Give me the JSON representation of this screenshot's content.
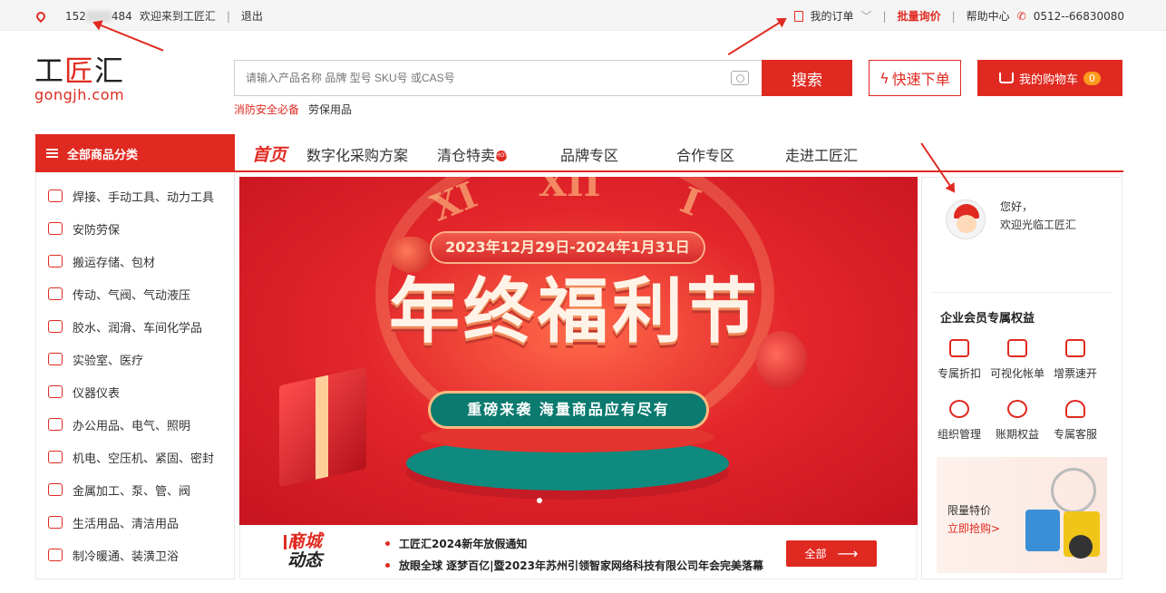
{
  "topbar": {
    "phone_masked_start": "152",
    "phone_masked_end": "484",
    "welcome": "欢迎来到工匠汇",
    "logout": "退出",
    "my_orders": "我的订单",
    "bulk_inquiry": "批量询价",
    "help_center": "帮助中心",
    "hotline": "0512--66830080"
  },
  "logo": {
    "cn_main": "工",
    "cn_accent": "匠",
    "cn_end": "汇",
    "en": "gongjh.com"
  },
  "search": {
    "placeholder": "请输入产品名称 品牌 型号 SKU号 或CAS号",
    "button": "搜索",
    "hotwords": [
      "消防安全必备",
      "劳保用品"
    ]
  },
  "quick_order": "快速下单",
  "cart": {
    "label": "我的购物车",
    "count": "0"
  },
  "nav": {
    "all_categories": "全部商品分类",
    "home": "首页",
    "items": [
      "数字化采购方案",
      "清仓特卖",
      "品牌专区",
      "合作专区",
      "走进工匠汇"
    ],
    "hot_badge": "HOT"
  },
  "categories": [
    "焊接、手动工具、动力工具",
    "安防劳保",
    "搬运存储、包材",
    "传动、气阀、气动液压",
    "胶水、润滑、车间化学品",
    "实验室、医疗",
    "仪器仪表",
    "办公用品、电气、照明",
    "机电、空压机、紧固、密封",
    "金属加工、泵、管、阀",
    "生活用品、清洁用品",
    "制冷暖通、装潢卫浴"
  ],
  "banner": {
    "date_range": "2023年12月29日-2024年1月31日",
    "title": "年终福利节",
    "slogan": "重磅来袭 海量商品应有尽有",
    "numerals": [
      "XI",
      "XII",
      "I"
    ]
  },
  "news": {
    "badge_line1": "商城",
    "badge_line2": "动态",
    "items": [
      "工匠汇2024新年放假通知",
      "放眼全球 逐梦百亿|暨2023年苏州引领智家网络科技有限公司年会完美落幕"
    ],
    "all_button": "全部"
  },
  "user_panel": {
    "greeting": "您好，",
    "welcome": "欢迎光临工匠汇",
    "benefits_title": "企业会员专属权益",
    "benefits": [
      "专属折扣",
      "可视化帐单",
      "增票速开",
      "组织管理",
      "账期权益",
      "专属客服"
    ],
    "promo_title": "限量特价",
    "promo_link": "立即抢购>"
  },
  "colors": {
    "brand_red": "#e02a21",
    "teal": "#0b7a6f",
    "cart_count": "#ff9a1e"
  }
}
